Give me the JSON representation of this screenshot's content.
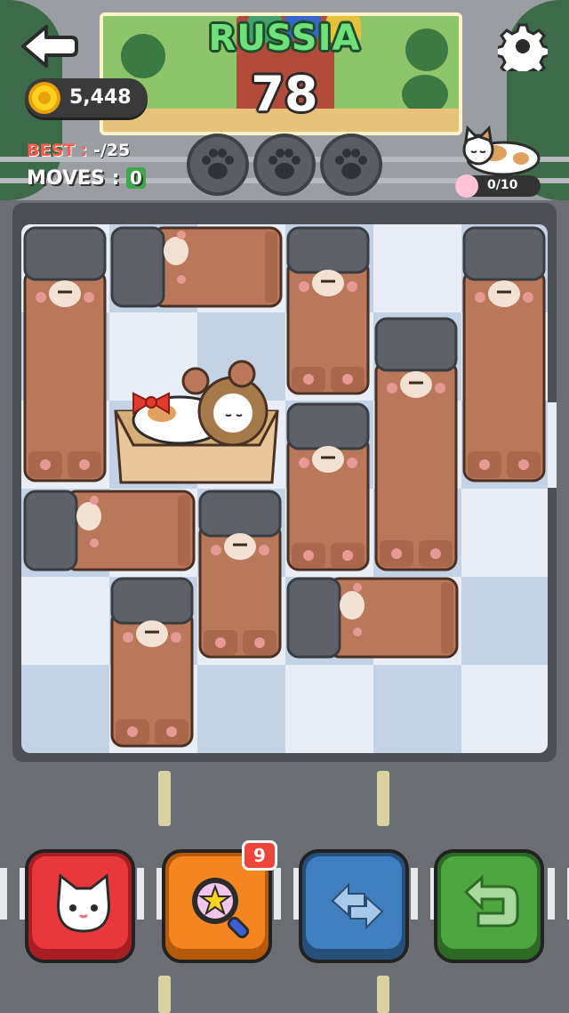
{
  "header": {
    "level_name": "RUSSIA",
    "level_number": "78"
  },
  "stats": {
    "coins": "5,448",
    "best_label": "BEST :",
    "best_value": "-/25",
    "moves_label": "MOVES :",
    "moves_value": "0"
  },
  "cat_collection": {
    "progress": "0/10"
  },
  "paw_stars": {
    "earned": 0,
    "total": 3
  },
  "actions": {
    "hint_badge_count": "9"
  },
  "icons": {
    "back": "back-arrow-icon",
    "settings": "gear-icon",
    "coin": "coin-icon",
    "paw": "paw-icon",
    "cat_button": "cat-face-icon",
    "hint": "magnifier-star-icon",
    "shuffle": "shuffle-arrows-icon",
    "undo": "undo-arrow-icon"
  },
  "colors": {
    "title_green": "#6fe07a",
    "best_red": "#ff5a4e",
    "bear_brown": "#b9785a",
    "hat_gray": "#5e6268",
    "cat_button": "#e8383c",
    "hint_button": "#f5861f",
    "shuffle_button": "#3f7fbf",
    "undo_button": "#4ea641"
  }
}
